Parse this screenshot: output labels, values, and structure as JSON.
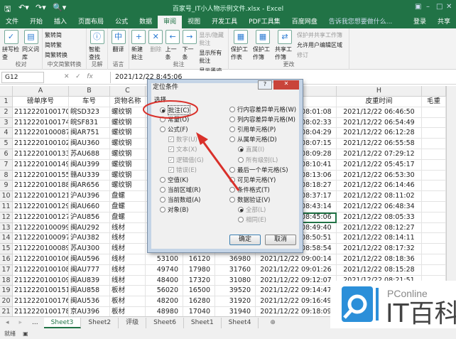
{
  "title": "百家号_IT小人物示例文件.xlsx - Excel",
  "quick_access": [
    "save-icon",
    "undo-icon",
    "redo-icon",
    "print-preview-icon"
  ],
  "ribbon_tabs": [
    "文件",
    "开始",
    "插入",
    "页面布局",
    "公式",
    "数据",
    "审阅",
    "视图",
    "开发工具",
    "PDF工具集",
    "百度网盘"
  ],
  "active_tab": "审阅",
  "tell_me": "告诉我您想要做什么...",
  "login": "登录",
  "share": "共享",
  "ribbon": {
    "proofing": {
      "label": "校对",
      "spell": "拼写检查",
      "thesaurus": "同义词库"
    },
    "chinese": {
      "label": "中文简繁转换",
      "t2s": "繁转简",
      "s2t": "简转繁",
      "convert": "简繁转换"
    },
    "insights": {
      "label": "见解",
      "smart": "智能查找"
    },
    "language": {
      "label": "语言",
      "translate": "翻译"
    },
    "comments": {
      "label": "批注",
      "new": "新建批注",
      "delete": "删除",
      "prev": "上一条",
      "next": "下一条",
      "show_hide": "显示/隐藏批注",
      "show_all": "显示所有批注",
      "show_ink": "显示墨迹"
    },
    "changes": {
      "label": "更改",
      "protect_sheet": "保护工作表",
      "protect_wb": "保护工作簿",
      "share_wb": "共享工作簿",
      "protect_share": "保护并共享工作簿",
      "allow_edit": "允许用户编辑区域",
      "track": "修订"
    }
  },
  "name_box": "G12",
  "formula": "2021/12/22  8:45:06",
  "columns": [
    "A",
    "B",
    "C",
    "H"
  ],
  "headers": {
    "A": "磅单序号",
    "B": "车号",
    "C": "货物名称",
    "G": "间",
    "H": "皮重时间",
    "I": "毛重"
  },
  "rows": [
    {
      "n": "1"
    },
    {
      "n": "2",
      "a": "2112220100170",
      "b": "皖SD323",
      "c": "螺纹钢",
      "g": "2021/12/22 08:01:08",
      "h": "2021/12/22 06:46:50"
    },
    {
      "n": "3",
      "a": "2112220100174",
      "b": "皖SF831",
      "c": "螺纹钢",
      "g": "2021/12/22 08:02:33",
      "h": "2021/12/22 06:54:49"
    },
    {
      "n": "4",
      "a": "2112220100087",
      "b": "闽AR751",
      "c": "螺纹钢",
      "g": "2021/12/22 08:04:29",
      "h": "2021/12/22 06:12:28"
    },
    {
      "n": "5",
      "a": "2112220100102",
      "b": "闽AU360",
      "c": "螺纹钢",
      "g": "2021/12/22 08:07:15",
      "h": "2021/12/22 06:55:58"
    },
    {
      "n": "6",
      "a": "2112220100133",
      "b": "苏AU688",
      "c": "螺纹钢",
      "g": "2021/12/22 08:09:28",
      "h": "2021/12/22 07:29:12"
    },
    {
      "n": "7",
      "a": "2112220100149",
      "b": "闽AU399",
      "c": "螺纹钢",
      "g": "2021/12/22 08:10:41",
      "h": "2021/12/22 05:45:17"
    },
    {
      "n": "8",
      "a": "2112220100155",
      "b": "赣AU339",
      "c": "螺纹钢",
      "g": "2021/12/22 08:13:06",
      "h": "2021/12/22 06:53:30"
    },
    {
      "n": "9",
      "a": "2112220100188",
      "b": "闽AR656",
      "c": "螺纹钢",
      "g": "2021/12/22 08:18:27",
      "h": "2021/12/22 06:14:46"
    },
    {
      "n": "10",
      "a": "2112220100121",
      "b": "沪AU396",
      "c": "盘螺",
      "g": "2021/12/22 08:37:17",
      "h": "2021/12/22 08:11:02"
    },
    {
      "n": "11",
      "a": "2112220100129",
      "b": "闽AU660",
      "c": "盘螺",
      "g": "2021/12/22 08:43:14",
      "h": "2021/12/22 06:48:34"
    },
    {
      "n": "12",
      "a": "2112220100127",
      "b": "沪AU856",
      "c": "盘螺",
      "g": "2021/12/22 08:45:06",
      "h": "2021/12/22 08:05:33"
    },
    {
      "n": "13",
      "a": "2112220100099",
      "b": "闽AU292",
      "c": "线材",
      "g": "2021/12/22 08:49:40",
      "h": "2021/12/22 08:12:27"
    },
    {
      "n": "14",
      "a": "2112220100097",
      "b": "沪AU382",
      "c": "线材",
      "g": "2021/12/22 08:50:51",
      "h": "2021/12/22 08:14:11"
    },
    {
      "n": "15",
      "a": "2112220100089",
      "b": "苏AU300",
      "c": "线材",
      "g": "2021/12/22 08:58:54",
      "h": "2021/12/22 08:17:32"
    },
    {
      "n": "16",
      "a": "2112220100106",
      "b": "闽AU596",
      "c": "线材",
      "d": "53100",
      "e": "16120",
      "f": "36980",
      "g": "2021/12/22 09:00:14",
      "h": "2021/12/22 08:18:36"
    },
    {
      "n": "17",
      "a": "2112220100108",
      "b": "闽AU777",
      "c": "线材",
      "d": "49740",
      "e": "17980",
      "f": "31760",
      "g": "2021/12/22 09:01:26",
      "h": "2021/12/22 08:15:28"
    },
    {
      "n": "18",
      "a": "2112220100109",
      "b": "闽AU839",
      "c": "线材",
      "d": "48400",
      "e": "17320",
      "f": "31080",
      "g": "2021/12/22 09:12:07",
      "h": "2021/12/22 08:21:51"
    },
    {
      "n": "19",
      "a": "2112220100151",
      "b": "闽AU858",
      "c": "板材",
      "d": "56020",
      "e": "16500",
      "f": "39520",
      "g": "2021/12/22 09:14:47"
    },
    {
      "n": "20",
      "a": "2112220100176",
      "b": "闽AU536",
      "c": "板材",
      "d": "48200",
      "e": "16280",
      "f": "31920",
      "g": "2021/12/22 09:16:49"
    },
    {
      "n": "21",
      "a": "2112220100178",
      "b": "京AU396",
      "c": "板材",
      "d": "48980",
      "e": "17040",
      "f": "31940",
      "g": "2021/12/22 09:18:09"
    }
  ],
  "dialog": {
    "title": "定位条件",
    "help": "?",
    "close": "✕",
    "section": "选择",
    "left": [
      {
        "label": "批注(C)",
        "on": true
      },
      {
        "label": "常量(O)"
      },
      {
        "label": "公式(F)"
      },
      {
        "label": "数字(U)",
        "chk": true
      },
      {
        "label": "文本(X)",
        "chk": true
      },
      {
        "label": "逻辑值(G)",
        "chk": true
      },
      {
        "label": "错误(E)",
        "chk": true
      },
      {
        "label": "空值(K)"
      },
      {
        "label": "当前区域(R)"
      },
      {
        "label": "当前数组(A)"
      },
      {
        "label": "对象(B)"
      }
    ],
    "right": [
      {
        "label": "行内容差异单元格(W)"
      },
      {
        "label": "列内容差异单元格(M)"
      },
      {
        "label": "引用单元格(P)"
      },
      {
        "label": "从属单元格(D)"
      },
      {
        "label": "直属(I)",
        "sub": true,
        "on": true
      },
      {
        "label": "所有级别(L)",
        "sub": true
      },
      {
        "label": "最后一个单元格(S)"
      },
      {
        "label": "可见单元格(Y)"
      },
      {
        "label": "条件格式(T)"
      },
      {
        "label": "数据验证(V)"
      },
      {
        "label": "全部(L)",
        "sub": true,
        "on": true
      },
      {
        "label": "相同(E)",
        "sub": true
      }
    ],
    "ok": "确定",
    "cancel": "取消"
  },
  "sheets": [
    "Sheet3",
    "Sheet2",
    "评级",
    "Sheet6",
    "Sheet1",
    "Sheet4"
  ],
  "active_sheet": "Sheet3",
  "sheet_nav_more": "...",
  "status": "就绪",
  "watermark": {
    "brand": "PConline",
    "name": "IT百科"
  },
  "colors": {
    "excel_green": "#217346",
    "annotation_red": "#d9302a",
    "logo_blue": "#2b8fd9"
  }
}
